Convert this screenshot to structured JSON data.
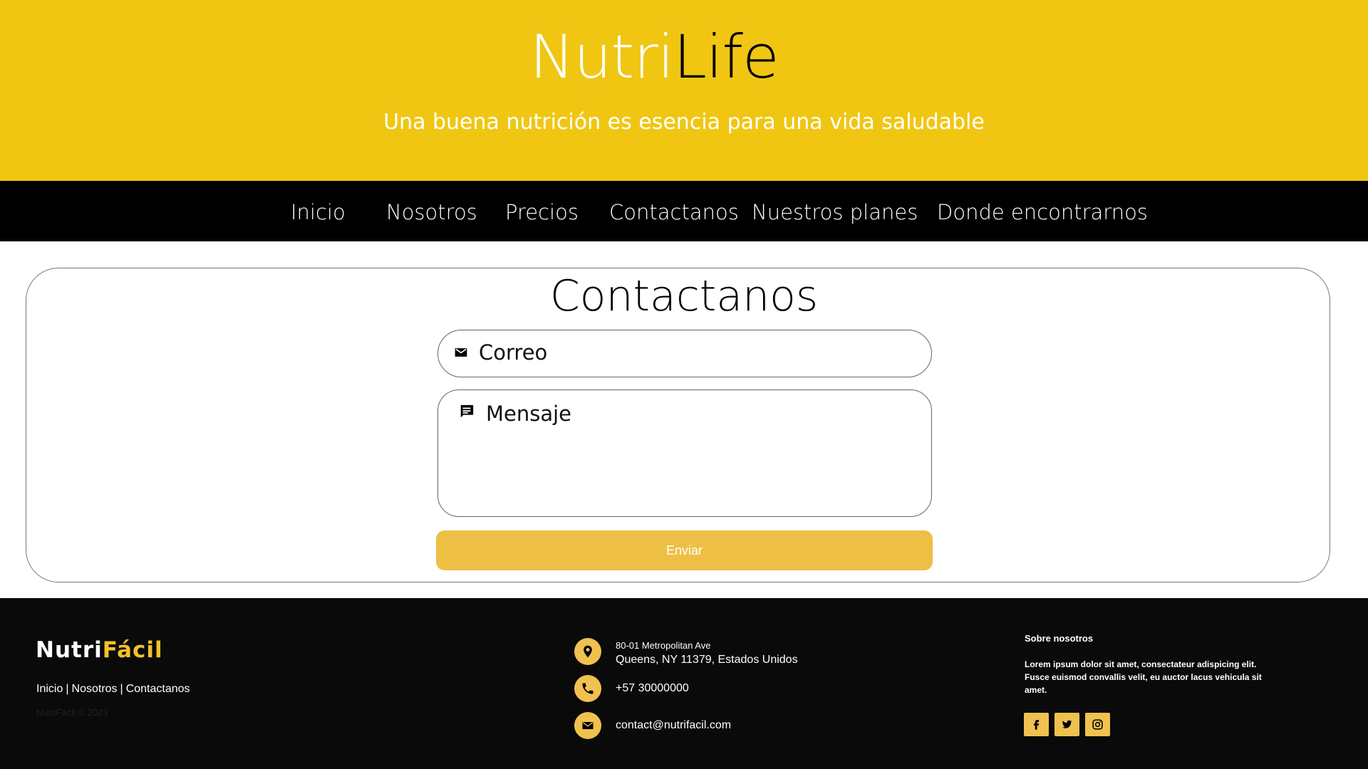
{
  "header": {
    "brand_part1": "Nutri",
    "brand_part2": "Life",
    "tagline": "Una buena nutrición es esencia para una vida saludable"
  },
  "nav": {
    "items": [
      {
        "label": "Inicio"
      },
      {
        "label": "Nosotros"
      },
      {
        "label": "Precios"
      },
      {
        "label": "Contactanos"
      },
      {
        "label": "Nuestros planes"
      },
      {
        "label": "Donde encontrarnos"
      }
    ]
  },
  "contact": {
    "title": "Contactanos",
    "email_placeholder": "Correo",
    "message_placeholder": "Mensaje",
    "submit_label": "Enviar"
  },
  "footer": {
    "logo_part1": "Nutri",
    "logo_part2": "Fácil",
    "links": [
      "Inicio",
      "Nosotros",
      "Contactanos"
    ],
    "copyright": "NutriFácil © 2023",
    "address_line1": "80-01 Metropolitan Ave",
    "address_line2": "Queens, NY 11379, Estados Unidos",
    "phone": "+57 30000000",
    "email": "contact@nutrifacil.com",
    "about_title": "Sobre nosotros",
    "about_text": "Lorem ipsum dolor sit amet, consectateur adispicing elit. Fusce euismod convallis velit, eu auctor lacus vehicula sit amet.",
    "social": [
      "facebook-icon",
      "twitter-icon",
      "instagram-icon"
    ]
  },
  "colors": {
    "header_bg": "#f0c613",
    "nav_bg": "#000000",
    "button_bg": "#edbf45",
    "footer_bg": "#0a0a0a",
    "accent": "#f0c14f"
  }
}
